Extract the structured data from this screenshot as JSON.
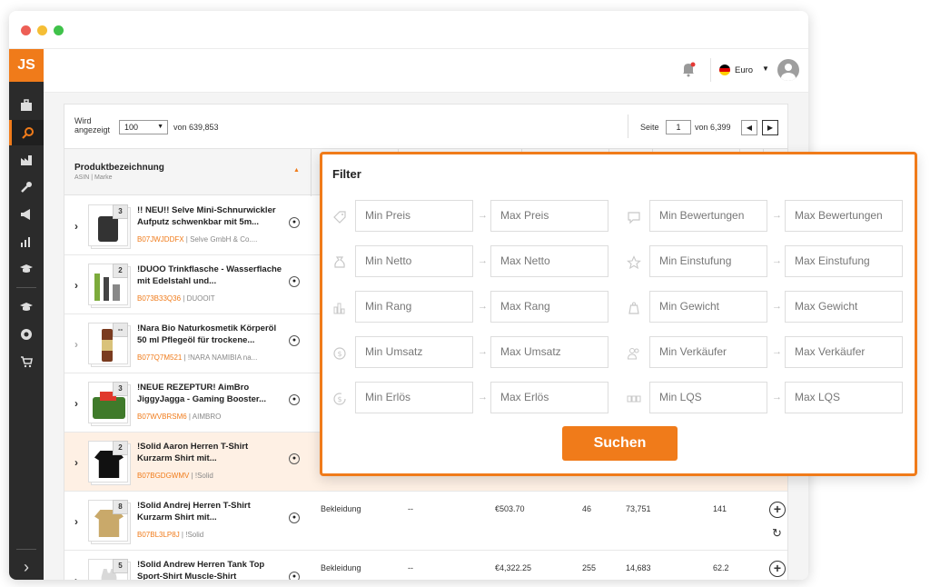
{
  "logo": "JS",
  "header": {
    "currency": "Euro"
  },
  "controls": {
    "shown_label_1": "Wird",
    "shown_label_2": "angezeigt",
    "page_size": "100",
    "of_total": "von 639,853",
    "page_label": "Seite",
    "page_number": "1",
    "of_pages": "von 6,399"
  },
  "table": {
    "col_product": "Produktbezeichnung",
    "col_product_sub": "ASIN | Marke",
    "rows": [
      {
        "count": "3",
        "name": "!! NEU!! Selve Mini-Schnurwickler Aufputz schwenkbar mit 5m...",
        "asin": "B07JWJDDFX",
        "brand": " | Selve GmbH & Co...."
      },
      {
        "count": "2",
        "name": "!DUOO Trinkflasche - Wasserflache mit Edelstahl und...",
        "asin": "B073B33Q36",
        "brand": " | DUOOIT"
      },
      {
        "count": "--",
        "name": "!Nara Bio Naturkosmetik Körperöl 50 ml Pflegeöl für trockene...",
        "asin": "B077Q7M521",
        "brand": " | !NARA NAMIBIA na..."
      },
      {
        "count": "3",
        "name": "!NEUE REZEPTUR! AimBro JiggyJagga - Gaming Booster...",
        "asin": "B07WVBRSM6",
        "brand": " | AIMBRO"
      },
      {
        "count": "2",
        "name": "!Solid Aaron Herren T-Shirt Kurzarm Shirt mit...",
        "asin": "B07BGDGWMV",
        "brand": " | !Solid"
      },
      {
        "count": "8",
        "name": "!Solid Andrej Herren T-Shirt Kurzarm Shirt mit...",
        "asin": "B07BL3LP8J",
        "brand": " | !Solid",
        "category": "Bekleidung",
        "dash": "--",
        "revenue": "€503.70",
        "reviews": "46",
        "rank": "73,751",
        "value": "141"
      },
      {
        "count": "5",
        "name": "!Solid Andrew Herren Tank Top Sport-Shirt Muscle-Shirt",
        "asin": "",
        "brand": "",
        "category": "Bekleidung",
        "dash": "--",
        "revenue": "€4,322.25",
        "reviews": "255",
        "rank": "14,683",
        "value": "62.2"
      }
    ]
  },
  "filter": {
    "title": "Filter",
    "fields": [
      {
        "min": "Min Preis",
        "max": "Max Preis",
        "icon": "price-tag-icon"
      },
      {
        "min": "Min Netto",
        "max": "Max Netto",
        "icon": "money-bag-icon"
      },
      {
        "min": "Min Rang",
        "max": "Max Rang",
        "icon": "bar-chart-icon"
      },
      {
        "min": "Min Umsatz",
        "max": "Max Umsatz",
        "icon": "dollar-circle-icon"
      },
      {
        "min": "Min Erlös",
        "max": "Max Erlös",
        "icon": "revenue-icon"
      },
      {
        "min": "Min Bewertungen",
        "max": "Max Bewertungen",
        "icon": "comment-icon"
      },
      {
        "min": "Min Einstufung",
        "max": "Max Einstufung",
        "icon": "star-icon"
      },
      {
        "min": "Min Gewicht",
        "max": "Max Gewicht",
        "icon": "weight-icon"
      },
      {
        "min": "Min Verkäufer",
        "max": "Max Verkäufer",
        "icon": "sellers-icon"
      },
      {
        "min": "Min LQS",
        "max": "Max LQS",
        "icon": "lqs-icon"
      }
    ],
    "submit": "Suchen"
  },
  "colors": {
    "accent": "#f07b1a",
    "sidebar": "#2b2b2b"
  }
}
